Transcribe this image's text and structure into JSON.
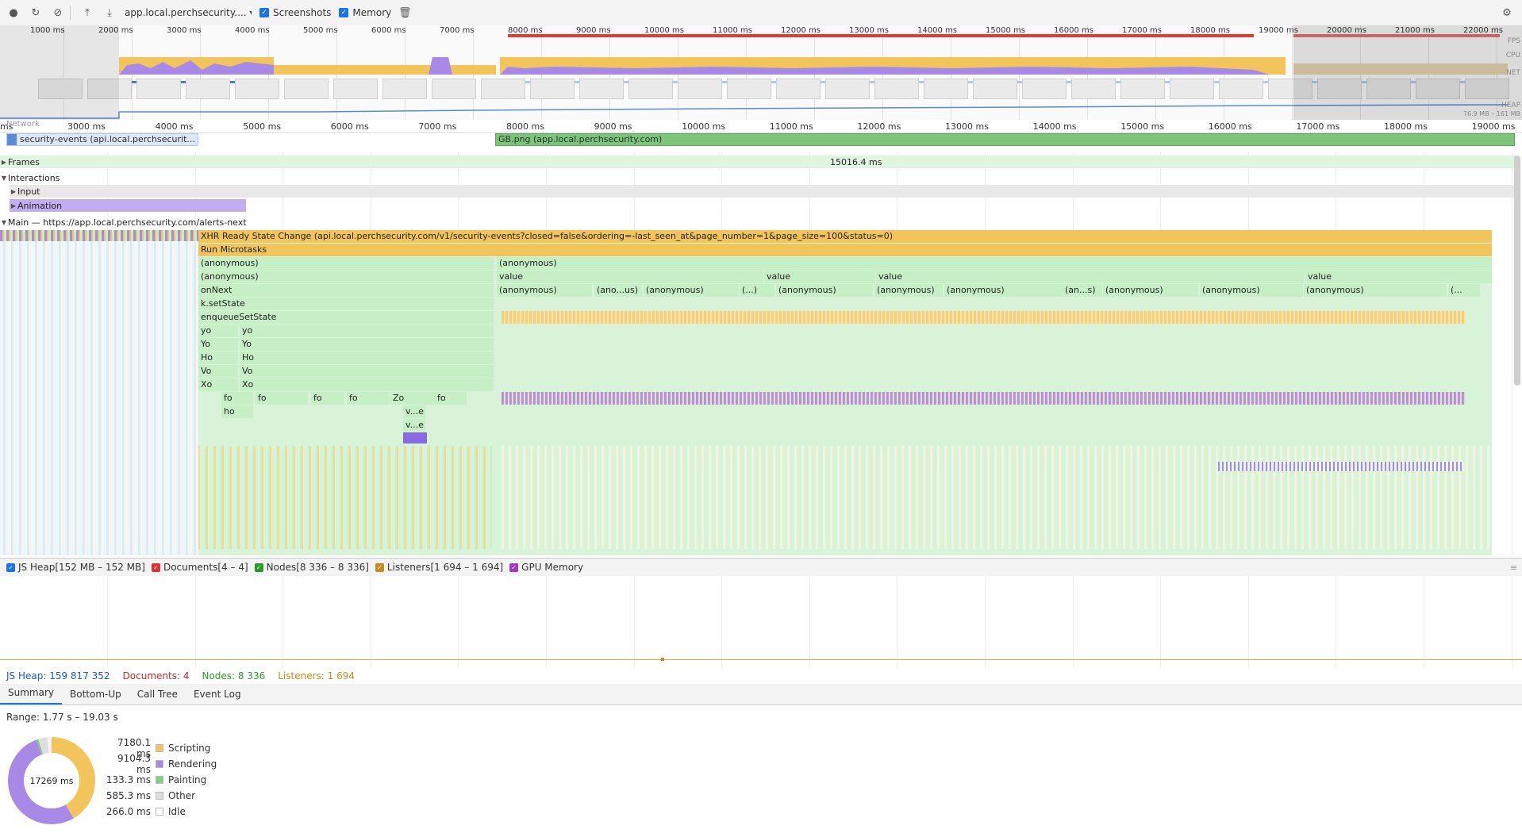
{
  "toolbar": {
    "url": "app.local.perchsecurity....",
    "screenshots_label": "Screenshots",
    "memory_label": "Memory"
  },
  "overview": {
    "ticks": [
      "1000 ms",
      "2000 ms",
      "3000 ms",
      "4000 ms",
      "5000 ms",
      "6000 ms",
      "7000 ms",
      "8000 ms",
      "9000 ms",
      "10000 ms",
      "11000 ms",
      "12000 ms",
      "13000 ms",
      "14000 ms",
      "15000 ms",
      "16000 ms",
      "17000 ms",
      "18000 ms",
      "19000 ms",
      "20000 ms",
      "21000 ms",
      "22000 ms"
    ],
    "fps_label": "FPS",
    "cpu_label": "CPU",
    "net_label": "NET",
    "heap_label": "HEAP",
    "heap_range": "76.9 MB – 161 MB"
  },
  "ruler": {
    "ticks": [
      "3000 ms",
      "4000 ms",
      "5000 ms",
      "6000 ms",
      "7000 ms",
      "8000 ms",
      "9000 ms",
      "10000 ms",
      "11000 ms",
      "12000 ms",
      "13000 ms",
      "14000 ms",
      "15000 ms",
      "16000 ms",
      "17000 ms",
      "18000 ms",
      "19000 ms"
    ],
    "leading": "ms"
  },
  "network": {
    "label": "Network",
    "req1": "security-events (api.local.perchsecurit...",
    "req2": "GB.png (app.local.perchsecurity.com)"
  },
  "tracks": {
    "frames": "Frames",
    "frames_duration": "15016.4 ms",
    "interactions": "Interactions",
    "input": "Input",
    "animation": "Animation",
    "main": "Main — https://app.local.perchsecurity.com/alerts-next"
  },
  "flame": {
    "xhr": "XHR Ready State Change (api.local.perchsecurity.com/v1/security-events?closed=false&ordering=-last_seen_at&page_number=1&page_size=100&status=0)",
    "run_microtasks": "Run Microtasks",
    "anonymous": "(anonymous)",
    "value": "value",
    "onnext": "onNext",
    "anon_short1": "(ano...us)",
    "anon_short2": "(...)",
    "anon_short3": "(an...s)",
    "anon_short4": "(...",
    "ksetstate": "k.setState",
    "enqueue": "enqueueSetState",
    "yo": "yo",
    "Yo": "Yo",
    "Ho": "Ho",
    "Vo": "Vo",
    "Xo": "Xo",
    "fo": "fo",
    "Zo": "Zo",
    "ho": "ho",
    "ve": "v...e"
  },
  "counters": {
    "js_heap": "JS Heap[152 MB – 152 MB]",
    "documents": "Documents[4 – 4]",
    "nodes": "Nodes[8 336 – 8 336]",
    "listeners": "Listeners[1 694 – 1 694]",
    "gpu": "GPU Memory"
  },
  "memlegend": {
    "js_heap": "JS Heap: 159 817 352",
    "documents": "Documents: 4",
    "nodes": "Nodes: 8 336",
    "listeners": "Listeners: 1 694"
  },
  "tabs": [
    "Summary",
    "Bottom-Up",
    "Call Tree",
    "Event Log"
  ],
  "summary": {
    "range": "Range: 1.77 s – 19.03 s",
    "total": "17269 ms",
    "rows": [
      {
        "value": "7180.1 ms",
        "label": "Scripting",
        "color": "#f2c55c"
      },
      {
        "value": "9104.3 ms",
        "label": "Rendering",
        "color": "#a88ae6"
      },
      {
        "value": "133.3 ms",
        "label": "Painting",
        "color": "#7fcf7f"
      },
      {
        "value": "585.3 ms",
        "label": "Other",
        "color": "#dedede"
      },
      {
        "value": "266.0 ms",
        "label": "Idle",
        "color": "#ffffff"
      }
    ]
  }
}
